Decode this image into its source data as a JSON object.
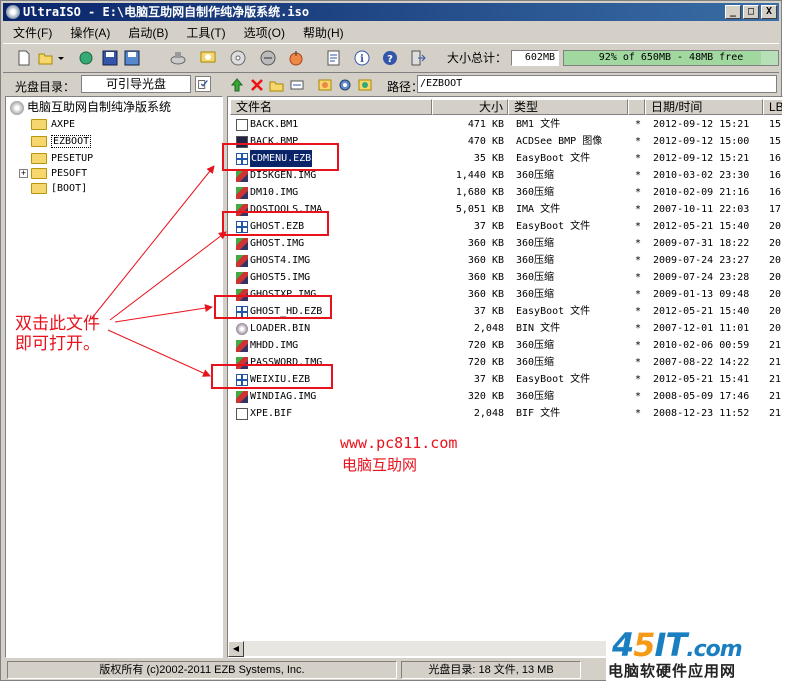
{
  "window": {
    "title": "UltraISO - E:\\电脑互助网自制作纯净版系统.iso",
    "min": "_",
    "max": "□",
    "close": "X"
  },
  "menu": [
    "文件(F)",
    "操作(A)",
    "启动(B)",
    "工具(T)",
    "选项(O)",
    "帮助(H)"
  ],
  "toolbar": {
    "size_label": "大小总计：",
    "size_value": "602MB",
    "capacity_text": "92% of 650MB - 48MB free",
    "capacity_fraction": 0.92,
    "icons": [
      "new-icon",
      "open-icon",
      "open-dropdown-icon",
      "extract-icon",
      "save-icon",
      "save-as-icon",
      "burn-icon",
      "mount-icon",
      "make-cd-image-icon",
      "convert-icon",
      "compress-icon",
      "properties-icon",
      "info-icon",
      "help-icon",
      "exit-icon"
    ]
  },
  "left_panel": {
    "label": "光盘目录：",
    "boot_button": "可引导光盘",
    "tree": {
      "root": "电脑互助网自制纯净版系统",
      "children": [
        "AXPE",
        "EZBOOT",
        "PESETUP",
        "PESOFT",
        "[BOOT]"
      ]
    }
  },
  "right_panel": {
    "path_label": "路径：",
    "path": "/EZBOOT",
    "columns": [
      "文件名",
      "大小",
      "类型",
      "日期/时间",
      "LB"
    ],
    "files": [
      {
        "name": "BACK.BM1",
        "size": "471 KB",
        "type": "BM1 文件",
        "flag": "*",
        "date": "2012-09-12 15:21",
        "lba": "15",
        "icon": "doc"
      },
      {
        "name": "BACK.BMP",
        "size": "470 KB",
        "type": "ACDSee BMP 图像",
        "flag": "*",
        "date": "2012-09-12 15:00",
        "lba": "15",
        "icon": "bmp"
      },
      {
        "name": "CDMENU.EZB",
        "size": "35 KB",
        "type": "EasyBoot 文件",
        "flag": "*",
        "date": "2012-09-12 15:21",
        "lba": "16",
        "icon": "ezb",
        "selected": true
      },
      {
        "name": "DISKGEN.IMG",
        "size": "1,440 KB",
        "type": "360压缩",
        "flag": "*",
        "date": "2010-03-02 23:30",
        "lba": "16",
        "icon": "img"
      },
      {
        "name": "DM10.IMG",
        "size": "1,680 KB",
        "type": "360压缩",
        "flag": "*",
        "date": "2010-02-09 21:16",
        "lba": "16",
        "icon": "img"
      },
      {
        "name": "DOSTOOLS.IMA",
        "size": "5,051 KB",
        "type": "IMA 文件",
        "flag": "*",
        "date": "2007-10-11 22:03",
        "lba": "17",
        "icon": "img"
      },
      {
        "name": "GHOST.EZB",
        "size": "37 KB",
        "type": "EasyBoot 文件",
        "flag": "*",
        "date": "2012-05-21 15:40",
        "lba": "20",
        "icon": "ezb"
      },
      {
        "name": "GHOST.IMG",
        "size": "360 KB",
        "type": "360压缩",
        "flag": "*",
        "date": "2009-07-31 18:22",
        "lba": "20",
        "icon": "img"
      },
      {
        "name": "GHOST4.IMG",
        "size": "360 KB",
        "type": "360压缩",
        "flag": "*",
        "date": "2009-07-24 23:27",
        "lba": "20",
        "icon": "img"
      },
      {
        "name": "GHOST5.IMG",
        "size": "360 KB",
        "type": "360压缩",
        "flag": "*",
        "date": "2009-07-24 23:28",
        "lba": "20",
        "icon": "img"
      },
      {
        "name": "GHOSTXP.IMG",
        "size": "360 KB",
        "type": "360压缩",
        "flag": "*",
        "date": "2009-01-13 09:48",
        "lba": "20",
        "icon": "img"
      },
      {
        "name": "GHOST_HD.EZB",
        "size": "37 KB",
        "type": "EasyBoot 文件",
        "flag": "*",
        "date": "2012-05-21 15:40",
        "lba": "20",
        "icon": "ezb"
      },
      {
        "name": "LOADER.BIN",
        "size": "2,048",
        "type": "BIN 文件",
        "flag": "*",
        "date": "2007-12-01 11:01",
        "lba": "20",
        "icon": "bin"
      },
      {
        "name": "MHDD.IMG",
        "size": "720 KB",
        "type": "360压缩",
        "flag": "*",
        "date": "2010-02-06 00:59",
        "lba": "21",
        "icon": "img"
      },
      {
        "name": "PASSWORD.IMG",
        "size": "720 KB",
        "type": "360压缩",
        "flag": "*",
        "date": "2007-08-22 14:22",
        "lba": "21",
        "icon": "img"
      },
      {
        "name": "WEIXIU.EZB",
        "size": "37 KB",
        "type": "EasyBoot 文件",
        "flag": "*",
        "date": "2012-05-21 15:41",
        "lba": "21",
        "icon": "ezb"
      },
      {
        "name": "WINDIAG.IMG",
        "size": "320 KB",
        "type": "360压缩",
        "flag": "*",
        "date": "2008-05-09 17:46",
        "lba": "21",
        "icon": "img"
      },
      {
        "name": "XPE.BIF",
        "size": "2,048",
        "type": "BIF 文件",
        "flag": "*",
        "date": "2008-12-23 11:52",
        "lba": "21",
        "icon": "doc"
      }
    ]
  },
  "statusbar": {
    "copyright": "版权所有 (c)2002-2011 EZB Systems, Inc.",
    "cd_dir": "光盘目录: 18 文件, 13 MB"
  },
  "annotation": {
    "line1": "双击此文件",
    "line2": "即可打开。"
  },
  "watermark": {
    "url": "www.pc811.com",
    "site": "电脑互助网"
  },
  "logo": {
    "brand_a": "4",
    "brand_b": "5",
    "brand_c": "IT",
    "brand_d": ".com",
    "sub": "电脑软硬件应用网"
  },
  "colors": {
    "accent_red": "#e8121c",
    "title_bar": "#0a246a",
    "selection": "#0a246a"
  }
}
